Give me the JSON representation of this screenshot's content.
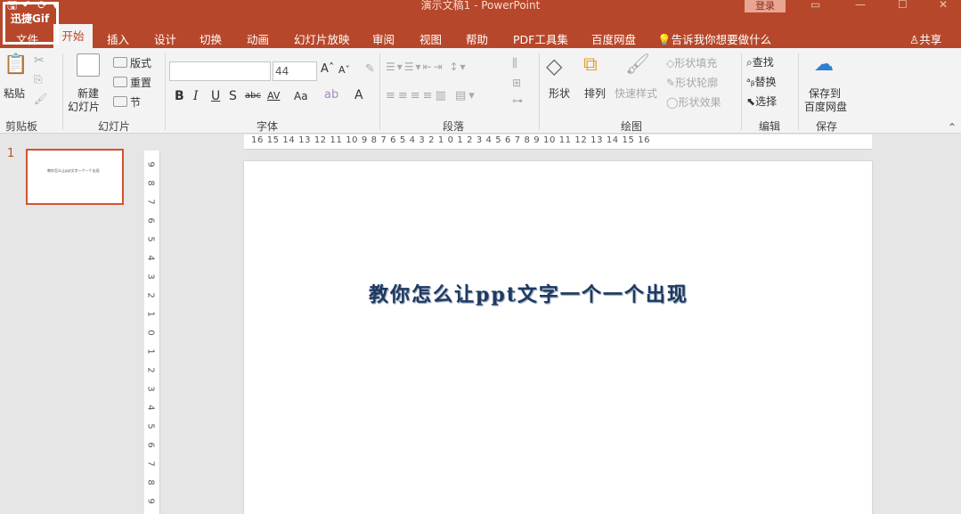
{
  "window": {
    "title": "演示文稿1  -  PowerPoint",
    "login_label": "登录",
    "restore_icon": "restore-icon",
    "minimize_icon": "minimize-icon",
    "maximize_icon": "maximize-icon",
    "close_icon": "close-icon"
  },
  "watermark": "迅捷Gif",
  "tabs": {
    "file": "文件",
    "items": [
      "开始",
      "插入",
      "设计",
      "切换",
      "动画",
      "幻灯片放映",
      "审阅",
      "视图",
      "帮助",
      "PDF工具集",
      "百度网盘"
    ],
    "active": "开始",
    "tell_me": "告诉我你想要做什么",
    "share": "共享"
  },
  "ribbon": {
    "clipboard": {
      "paste": "粘贴",
      "label": "剪贴板"
    },
    "slides": {
      "new_slide_line1": "新建",
      "new_slide_line2": "幻灯片",
      "layout": "版式",
      "reset": "重置",
      "section": "节",
      "label": "幻灯片"
    },
    "font": {
      "font_name": "",
      "font_size": "44",
      "bold": "B",
      "italic": "I",
      "underline": "U",
      "shadow": "S",
      "strike": "abc",
      "spacing": "AV",
      "case": "Aa",
      "label": "字体"
    },
    "paragraph": {
      "label": "段落"
    },
    "drawing": {
      "shapes": "形状",
      "arrange": "排列",
      "quick_styles": "快速样式",
      "fill": "形状填充",
      "outline": "形状轮廓",
      "effects": "形状效果",
      "label": "绘图"
    },
    "editing": {
      "find": "查找",
      "replace": "替换",
      "select": "选择",
      "label": "编辑"
    },
    "save": {
      "line1": "保存到",
      "line2": "百度网盘",
      "label": "保存"
    }
  },
  "thumbnails": [
    {
      "number": "1",
      "text": "教你怎么让ppt文字一个一个出现"
    }
  ],
  "hruler_text": "16 15 14 13 12 11 10 9 8 7 6 5 4 3 2 1 0 1 2 3 4 5 6 7 8 9 10 11 12 13 14 15 16",
  "vruler_labels": [
    "9",
    "8",
    "7",
    "6",
    "5",
    "4",
    "3",
    "2",
    "1",
    "0",
    "1",
    "2",
    "3",
    "4",
    "5",
    "6",
    "7",
    "8",
    "9"
  ],
  "slide": {
    "title_text": "教你怎么让ppt文字一个一个出现"
  },
  "colors": {
    "accent": "#b7472a",
    "slide_text": "#1f3a60"
  }
}
